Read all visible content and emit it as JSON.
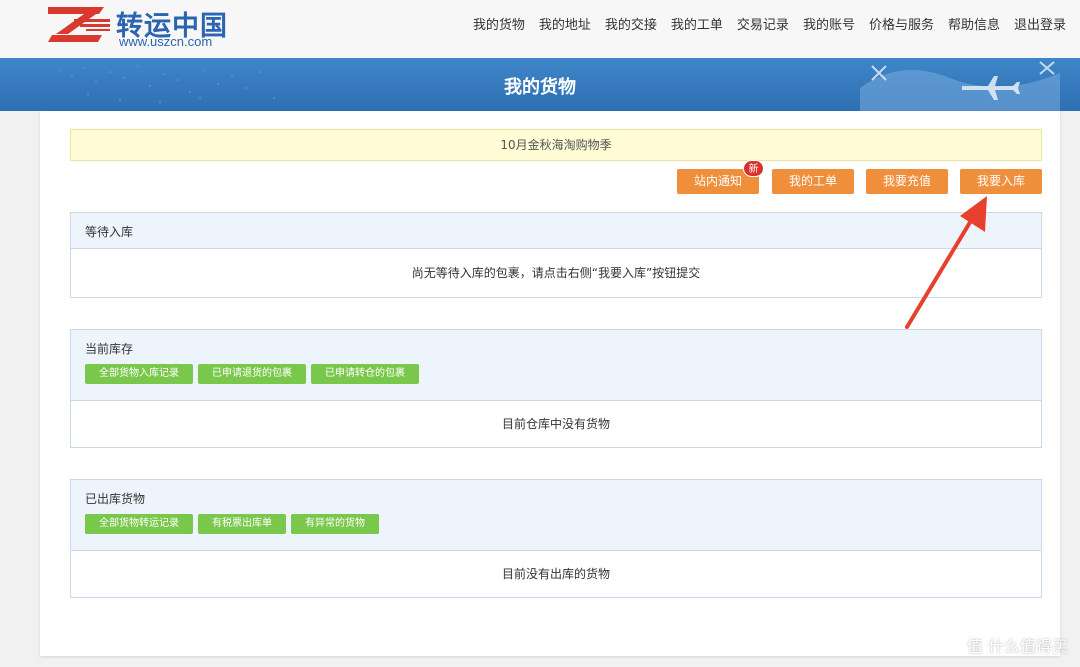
{
  "header": {
    "logo_title": "转运中国",
    "logo_url": "www.uszcn.com",
    "nav": [
      {
        "label": "我的货物"
      },
      {
        "label": "我的地址"
      },
      {
        "label": "我的交接"
      },
      {
        "label": "我的工单"
      },
      {
        "label": "交易记录"
      },
      {
        "label": "我的账号"
      },
      {
        "label": "价格与服务"
      },
      {
        "label": "帮助信息"
      },
      {
        "label": "退出登录"
      }
    ]
  },
  "banner": {
    "title": "我的货物"
  },
  "notice": {
    "text": "10月金秋海淘购物季"
  },
  "actions": {
    "site_notice": "站内通知",
    "badge_new": "新",
    "my_tickets": "我的工单",
    "recharge": "我要充值",
    "check_in": "我要入库"
  },
  "panels": {
    "awaiting": {
      "title": "等待入库",
      "empty_text": "尚无等待入库的包裹，请点击右侧“我要入库”按钮提交"
    },
    "inventory": {
      "title": "当前库存",
      "buttons": [
        "全部货物入库记录",
        "已申请退货的包裹",
        "已申请转仓的包裹"
      ],
      "empty_text": "目前仓库中没有货物"
    },
    "shipped": {
      "title": "已出库货物",
      "buttons": [
        "全部货物转运记录",
        "有税票出库单",
        "有异常的货物"
      ],
      "empty_text": "目前没有出库的货物"
    }
  },
  "watermark": {
    "text": "值 什么值得买"
  },
  "colors": {
    "brand_blue": "#2b64b0",
    "banner_blue": "#3579bd",
    "orange_button": "#f08f3b",
    "green_button": "#79c84b",
    "notice_yellow": "#fffcd6",
    "arrow_red": "#e8402f"
  },
  "icons": {
    "logo_mark": "speed-lines-z-icon",
    "arrow": "annotation-arrow-icon"
  }
}
